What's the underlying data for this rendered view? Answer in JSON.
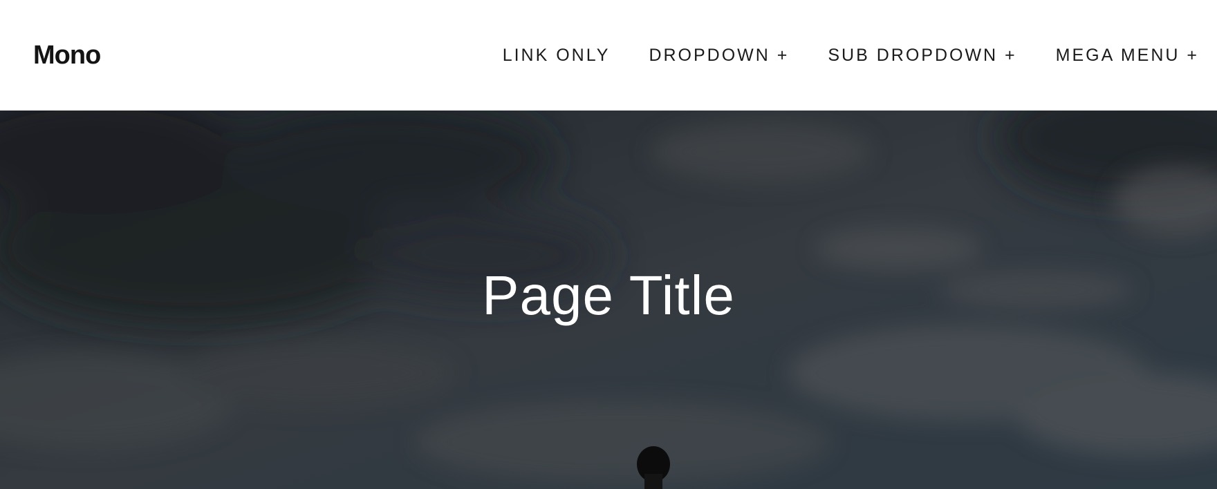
{
  "site": {
    "logo": "Mono"
  },
  "nav": {
    "items": [
      {
        "label": "LINK ONLY"
      },
      {
        "label": "DROPDOWN +"
      },
      {
        "label": "SUB DROPDOWN +"
      },
      {
        "label": "MEGA MENU +"
      }
    ]
  },
  "hero": {
    "title": "Page Title"
  },
  "colors": {
    "header_bg": "#ffffff",
    "text_dark": "#141414",
    "hero_text": "#ffffff",
    "hero_overlay": "#2c3238"
  }
}
